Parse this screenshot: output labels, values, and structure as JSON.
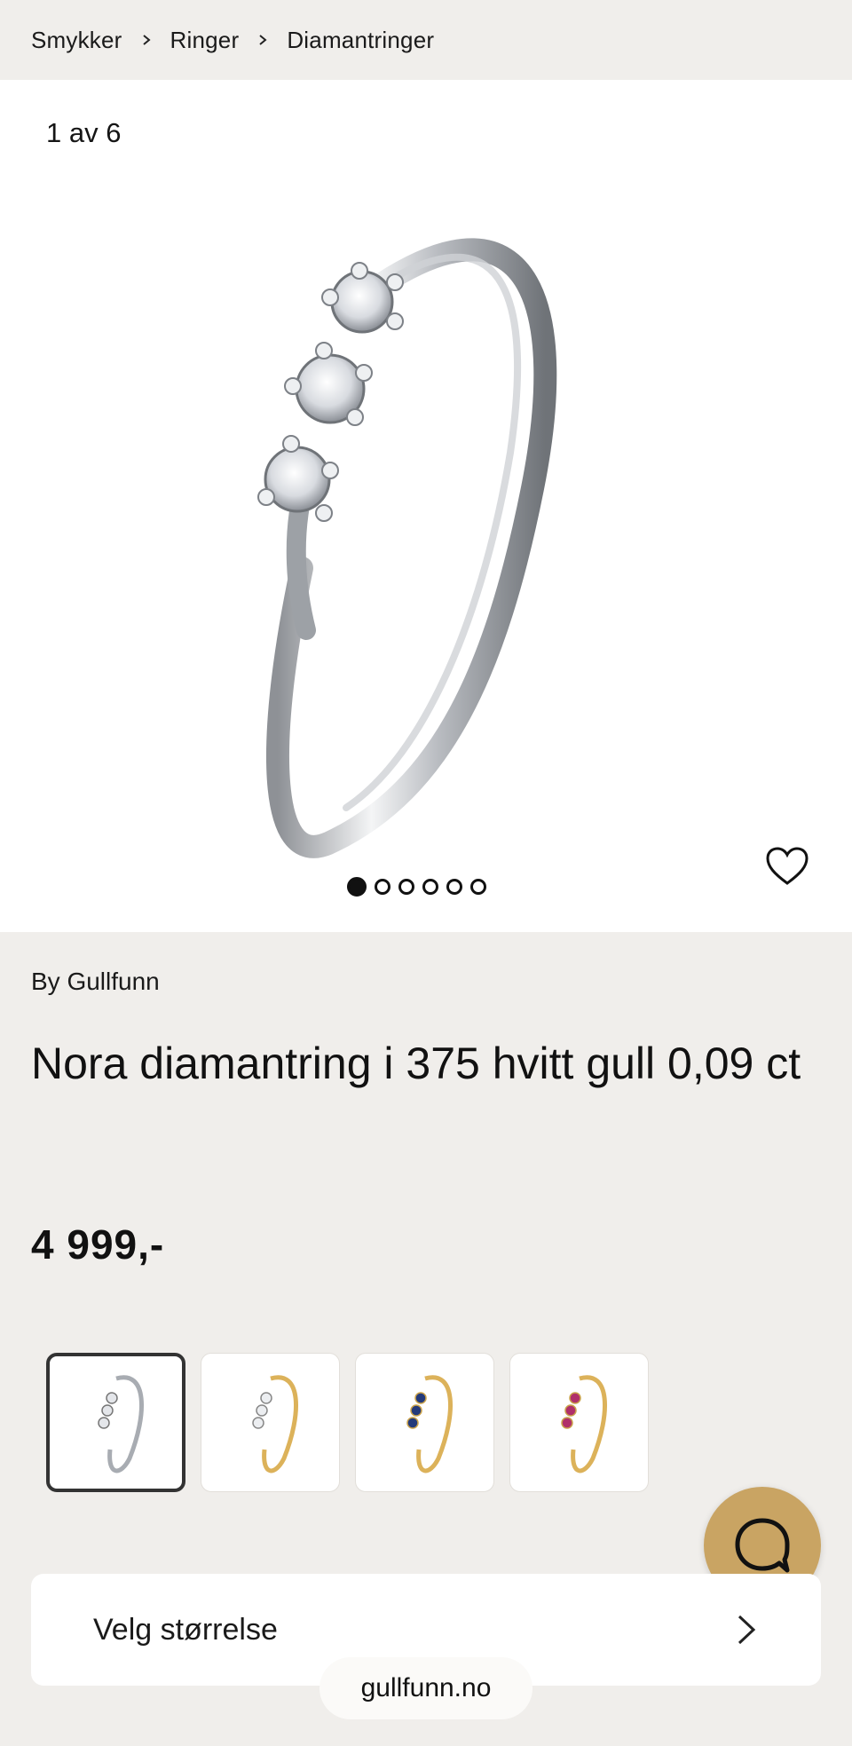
{
  "breadcrumb": {
    "items": [
      "Smykker",
      "Ringer",
      "Diamantringer"
    ]
  },
  "gallery": {
    "counter": "1 av 6",
    "total_images": 6,
    "active_index": 0,
    "favorite_icon": "heart-outline-icon"
  },
  "product": {
    "brand": "By Gullfunn",
    "title": "Nora diamantring i 375 hvitt gull 0,09 ct",
    "price": "4 999,-"
  },
  "variants": [
    {
      "name": "white-gold-diamond",
      "selected": true
    },
    {
      "name": "yellow-gold-diamond",
      "selected": false
    },
    {
      "name": "yellow-gold-sapphire",
      "selected": false
    },
    {
      "name": "yellow-gold-ruby",
      "selected": false
    }
  ],
  "size_selector": {
    "label": "Velg størrelse"
  },
  "chat": {
    "icon": "chat-bubble-icon",
    "color": "#c9a463"
  },
  "browser": {
    "url": "gullfunn.no"
  }
}
